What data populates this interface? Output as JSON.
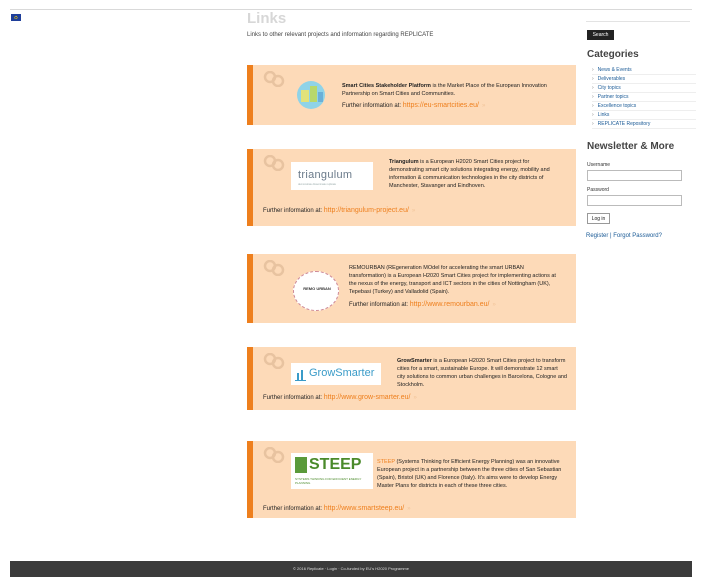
{
  "page": {
    "title": "Links",
    "intro": "Links to other relevant projects and information regarding REPLICATE"
  },
  "cards": [
    {
      "logo_text": "EIP",
      "desc_bold": "Smart Cities Stakeholder Platform",
      "desc_rest": " is the Market Place of the European Innovation Partnership on Smart Cities and Communities.",
      "more_label": "Further information at:",
      "url": "https://eu-smartcities.eu/",
      "arrow": "»"
    },
    {
      "logo_text": "triangulum",
      "logo_sub": "demonstrate disseminate replicate",
      "desc_bold": "Triangulum",
      "desc_rest": " is a European H2020 Smart Cities project for demonstrating smart city solutions integrating energy, mobility and information & communication technologies in the city districts of Manchester, Stavanger and Eindhoven.",
      "more_label": "Further information at:",
      "url": "http://triangulum-project.eu/",
      "arrow": "»"
    },
    {
      "logo_text": "REMO URBAN",
      "desc_bold": "",
      "desc_rest": "REMOURBAN (REgeneration MOdel for accelerating the smart URBAN transformation) is a European H2020 Smart Cities project for implementing actions at the nexus of the energy, transport and ICT sectors in the cities of Nottingham (UK), Tepebasi (Turkey) and Valladolid (Spain).",
      "more_label": "Further information at:",
      "url": "http://www.remourban.eu/",
      "arrow": "»"
    },
    {
      "logo_text": "GrowSmarter",
      "desc_bold": "GrowSmarter",
      "desc_rest": " is a European H2020 Smart Cities project to transform cities for a smart, sustainable Europe. It will demonstrate 12 smart city solutions to common urban challenges in Barcelona, Cologne and Stockholm.",
      "more_label": "Further information at:",
      "url": "http://www.grow-smarter.eu/",
      "arrow": "»"
    },
    {
      "logo_text": "STEEP",
      "logo_sub": "SYSTEMS THINKING FOR EFFICIENT ENERGY PLANNING",
      "desc_lead": "STEEP",
      "desc_rest": " (Systems Thinking for Efficient Energy Planning) was an innovative European project in a partnership between the three cities of San Sebastian (Spain), Bristol (UK) and Florence (Italy). It's aims were to develop Energy Master Plans for districts in each of these three cities.",
      "more_label": "Further information at:",
      "url": "http://www.smartsteep.eu/",
      "arrow": "»"
    }
  ],
  "sidebar": {
    "search_label": "Search",
    "categories_title": "Categories",
    "categories": [
      "News & Events",
      "Deliverables",
      "City topics",
      "Partner topics",
      "Excellence topics",
      "Links",
      "REPLICATE Repository"
    ],
    "newsletter_title": "Newsletter & More",
    "username_label": "Username",
    "password_label": "Password",
    "login_label": "Log in",
    "register_label": "Register",
    "separator": " | ",
    "forgot_label": "Forgot Password?"
  },
  "footer": {
    "text": "© 2016 Replicate · Login · Co-funded by EU's H2020 Programme"
  },
  "colors": {
    "card_bg": "#fddab8",
    "accent": "#ee7f1d",
    "link_blue": "#1a5a96",
    "footer_bg": "#3b3b3b"
  }
}
